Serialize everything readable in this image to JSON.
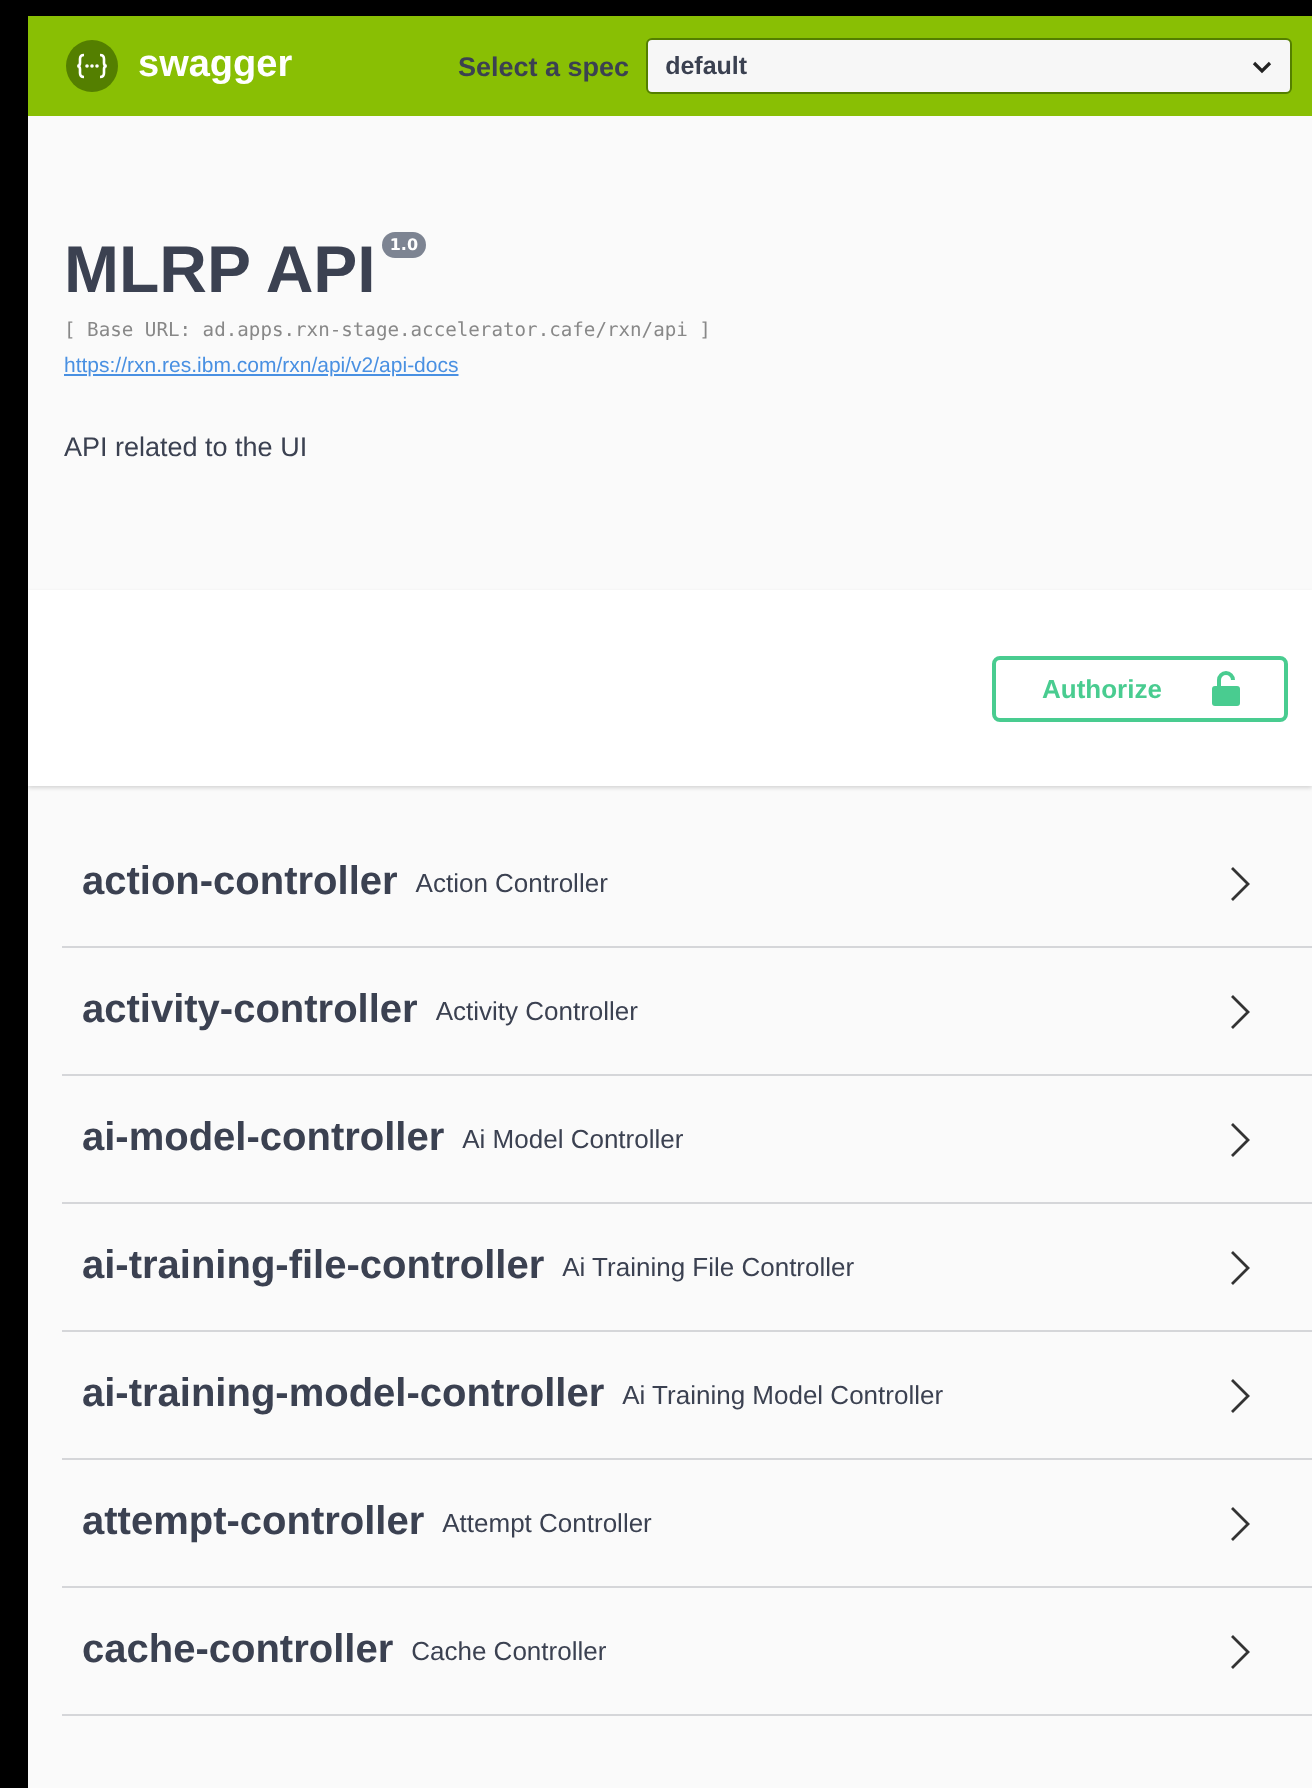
{
  "topbar": {
    "brand": "swagger",
    "spec_label": "Select a spec",
    "spec_value": "default"
  },
  "info": {
    "title": "MLRP API",
    "version": "1.0",
    "base_url": "[ Base URL: ad.apps.rxn-stage.accelerator.cafe/rxn/api ]",
    "docs_link": "https://rxn.res.ibm.com/rxn/api/v2/api-docs",
    "description": "API related to the UI"
  },
  "authorize": {
    "label": "Authorize"
  },
  "tags": [
    {
      "name": "action-controller",
      "description": "Action Controller",
      "expanded": false
    },
    {
      "name": "activity-controller",
      "description": "Activity Controller",
      "expanded": false
    },
    {
      "name": "ai-model-controller",
      "description": "Ai Model Controller",
      "expanded": false
    },
    {
      "name": "ai-training-file-controller",
      "description": "Ai Training File Controller",
      "expanded": false
    },
    {
      "name": "ai-training-model-controller",
      "description": "Ai Training Model Controller",
      "expanded": false
    },
    {
      "name": "attempt-controller",
      "description": "Attempt Controller",
      "expanded": false
    },
    {
      "name": "cache-controller",
      "description": "Cache Controller",
      "expanded": false
    }
  ]
}
